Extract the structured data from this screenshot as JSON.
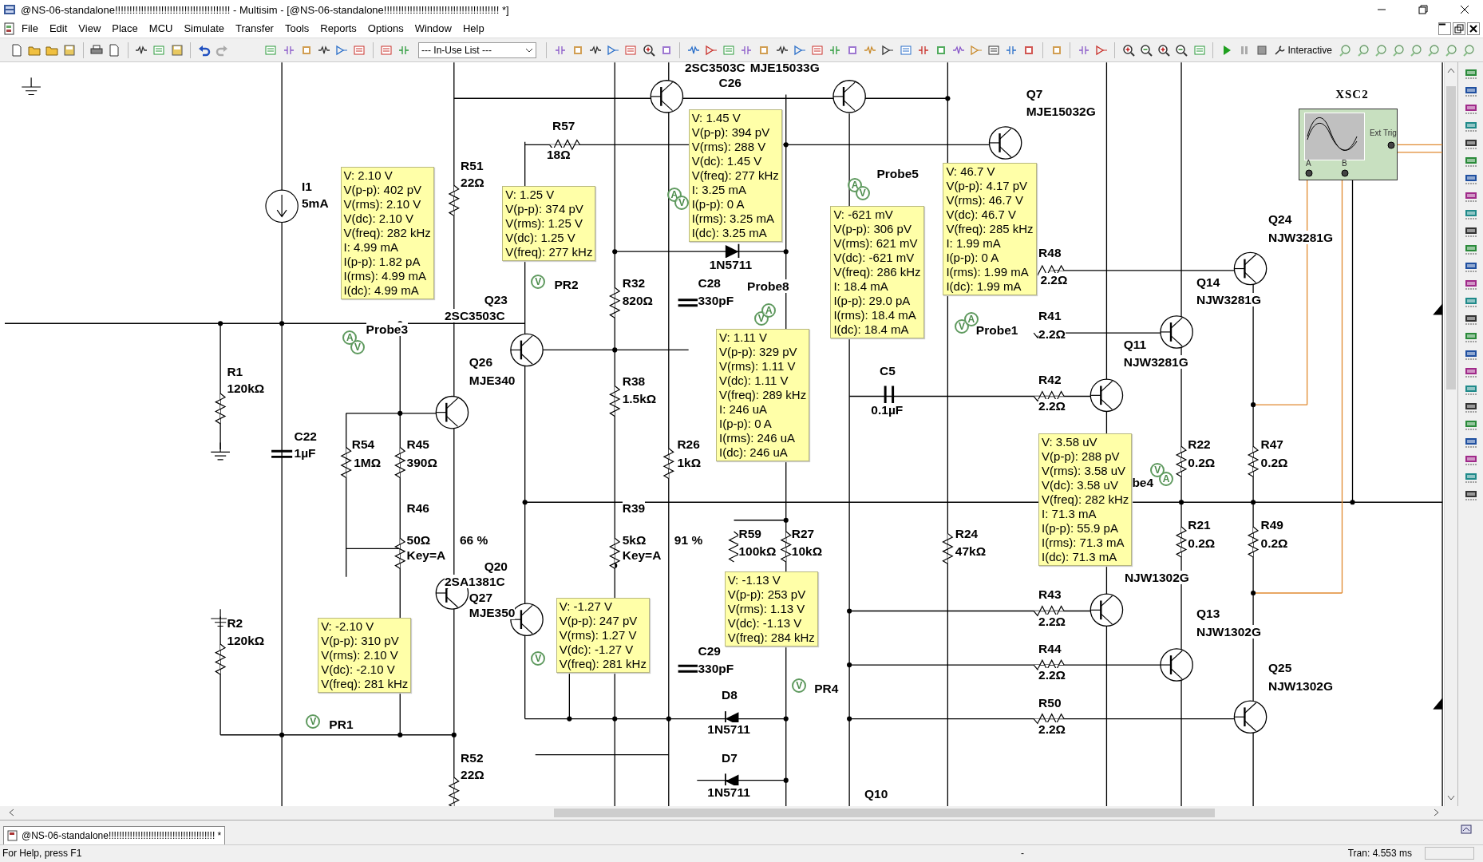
{
  "window": {
    "title": "@NS-06-standalone!!!!!!!!!!!!!!!!!!!!!!!!!!!!!!!!!!!!!!!! - Multisim - [@NS-06-standalone!!!!!!!!!!!!!!!!!!!!!!!!!!!!!!!!!!!!!!!! *]"
  },
  "menu": [
    "File",
    "Edit",
    "View",
    "Place",
    "MCU",
    "Simulate",
    "Transfer",
    "Tools",
    "Reports",
    "Options",
    "Window",
    "Help"
  ],
  "toolbar": {
    "dropdown": "--- In-Use List ---",
    "mode": "Interactive"
  },
  "canvas": {
    "labels": [
      "2SC3503C",
      "MJE15033G",
      "C26",
      "Q7",
      "MJE15032G",
      "R57",
      "18Ω",
      "R51",
      "Probe5",
      "I1",
      "22Ω",
      "5mA",
      "Q24",
      "NJW3281G",
      "R48",
      "1N5711",
      "PR2",
      "R32",
      "C28",
      "Probe8",
      "2.2Ω",
      "Q14",
      "Q23",
      "820Ω",
      "330pF",
      "NJW3281G",
      "2SC3503C",
      "R41",
      "Probe3",
      "Probe1",
      "2.2Ω",
      "Q11",
      "Q26",
      "NJW3281G",
      "R1",
      "C5",
      "MJE340",
      "R38",
      "R42",
      "120kΩ",
      "1.5kΩ",
      "0.1µF",
      "2.2Ω",
      "C22",
      "1µF",
      "R54",
      "R45",
      "R26",
      "R22",
      "R47",
      "1MΩ",
      "390Ω",
      "1kΩ",
      "0.2Ω",
      "0.2Ω",
      "be4",
      "R46",
      "R39",
      "R59",
      "R27",
      "R24",
      "R21",
      "R49",
      "50Ω",
      "66 %",
      "5kΩ",
      "91 %",
      "Key=A",
      "Key=A",
      "100kΩ",
      "10kΩ",
      "47kΩ",
      "0.2Ω",
      "0.2Ω",
      "Q20",
      "2SA1381C",
      "NJW1302G",
      "Q27",
      "R43",
      "R2",
      "MJE350",
      "2.2Ω",
      "Q13",
      "120kΩ",
      "NJW1302G",
      "C29",
      "R44",
      "330pF",
      "2.2Ω",
      "Q25",
      "D8",
      "PR4",
      "NJW1302G",
      "R50",
      "PR1",
      "1N5711",
      "2.2Ω",
      "R52",
      "D7",
      "22Ω",
      "1N5711",
      "Q10"
    ],
    "probe_readouts": [
      {
        "lines": [
          "V: 2.10 V",
          "V(p-p): 402 pV",
          "V(rms): 2.10 V",
          "V(dc): 2.10 V",
          "V(freq): 282 kHz",
          "I: 4.99 mA",
          "I(p-p): 1.82 pA",
          "I(rms): 4.99 mA",
          "I(dc): 4.99 mA"
        ]
      },
      {
        "lines": [
          "V: 1.25 V",
          "V(p-p): 374 pV",
          "V(rms): 1.25 V",
          "V(dc): 1.25 V",
          "V(freq): 277 kHz"
        ]
      },
      {
        "lines": [
          "V: 1.45 V",
          "V(p-p): 394 pV",
          "V(rms): 288 V",
          "V(dc): 1.45 V",
          "V(freq): 277 kHz",
          "I: 3.25 mA",
          "I(p-p): 0 A",
          "I(rms): 3.25 mA",
          "I(dc): 3.25 mA"
        ]
      },
      {
        "lines": [
          "V: -621 mV",
          "V(p-p): 306 pV",
          "V(rms): 621 mV",
          "V(dc): -621 mV",
          "V(freq): 286 kHz",
          "I: 18.4 mA",
          "I(p-p): 29.0 pA",
          "I(rms): 18.4 mA",
          "I(dc): 18.4 mA"
        ]
      },
      {
        "lines": [
          "V: 46.7 V",
          "V(p-p): 4.17 pV",
          "V(rms): 46.7 V",
          "V(dc): 46.7 V",
          "V(freq): 285 kHz",
          "I: 1.99 mA",
          "I(p-p): 0 A",
          "I(rms): 1.99 mA",
          "I(dc): 1.99 mA"
        ]
      },
      {
        "lines": [
          "V: 1.11 V",
          "V(p-p): 329 pV",
          "V(rms): 1.11 V",
          "V(dc): 1.11 V",
          "V(freq): 289 kHz",
          "I: 246 uA",
          "I(p-p): 0 A",
          "I(rms): 246 uA",
          "I(dc): 246 uA"
        ]
      },
      {
        "lines": [
          "V: 3.58 uV",
          "V(p-p): 288 pV",
          "V(rms): 3.58 uV",
          "V(dc): 3.58 uV",
          "V(freq): 282 kHz",
          "I: 71.3 mA",
          "I(p-p): 55.9 pA",
          "I(rms): 71.3 mA",
          "I(dc): 71.3 mA"
        ]
      },
      {
        "lines": [
          "V: -2.10 V",
          "V(p-p): 310 pV",
          "V(rms): 2.10 V",
          "V(dc): -2.10 V",
          "V(freq): 281 kHz"
        ]
      },
      {
        "lines": [
          "V: -1.27 V",
          "V(p-p): 247 pV",
          "V(rms): 1.27 V",
          "V(dc): -1.27 V",
          "V(freq): 281 kHz"
        ]
      },
      {
        "lines": [
          "V: -1.13 V",
          "V(p-p): 253 pV",
          "V(rms): 1.13 V",
          "V(dc): -1.13 V",
          "V(freq): 284 kHz"
        ]
      }
    ],
    "probe_symbols": [
      "A",
      "V",
      "A",
      "V",
      "V",
      "A",
      "V",
      "V",
      "A",
      "V",
      "A",
      "V",
      "A",
      "V",
      "V",
      "V"
    ],
    "oscilloscope": {
      "name": "XSC2",
      "trigger": "Ext Trig",
      "channels": [
        "A",
        "B"
      ]
    }
  },
  "tabs": [
    {
      "label": "@NS-06-standalone!!!!!!!!!!!!!!!!!!!!!!!!!!!!!!!!!!!!!!!! *",
      "selected": true
    }
  ],
  "status_bar": {
    "help": "For Help, press F1",
    "separator": "-",
    "time": "Tran: 4.553 ms"
  }
}
